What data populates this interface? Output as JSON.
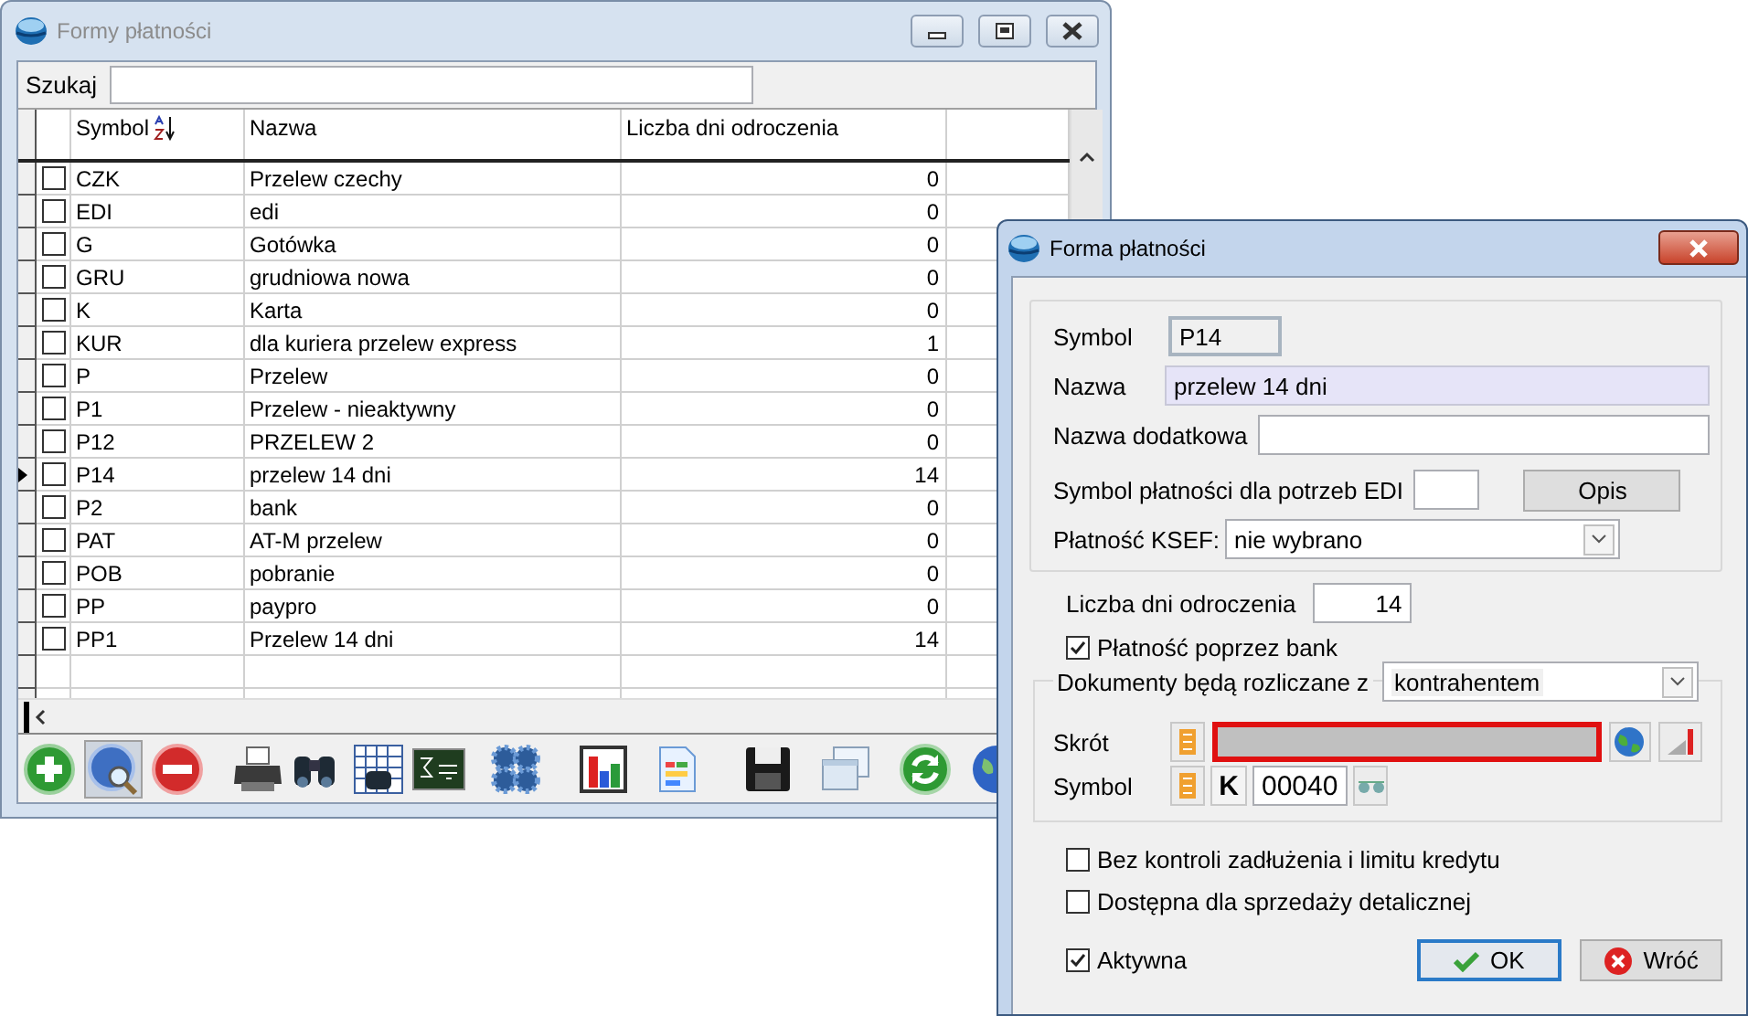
{
  "main_window": {
    "title": "Formy płatności",
    "active": false,
    "search": {
      "label": "Szukaj"
    },
    "table": {
      "columns": [
        "Symbol",
        "Nazwa",
        "Liczba dni odroczenia"
      ],
      "sorted_by_symbol": true,
      "rows": [
        {
          "symbol": "CZK",
          "name": "Przelew czechy",
          "days": "0",
          "checked": false,
          "selected": false
        },
        {
          "symbol": "EDI",
          "name": "edi",
          "days": "0",
          "checked": false,
          "selected": false
        },
        {
          "symbol": "G",
          "name": "Gotówka",
          "days": "0",
          "checked": false,
          "selected": false
        },
        {
          "symbol": "GRU",
          "name": "grudniowa nowa",
          "days": "0",
          "checked": false,
          "selected": false
        },
        {
          "symbol": "K",
          "name": "Karta",
          "days": "0",
          "checked": false,
          "selected": false
        },
        {
          "symbol": "KUR",
          "name": "dla kuriera przelew express",
          "days": "1",
          "checked": false,
          "selected": false
        },
        {
          "symbol": "P",
          "name": "Przelew",
          "days": "0",
          "checked": false,
          "selected": false
        },
        {
          "symbol": "P1",
          "name": "Przelew - nieaktywny",
          "days": "0",
          "checked": false,
          "selected": false
        },
        {
          "symbol": "P12",
          "name": "PRZELEW 2",
          "days": "0",
          "checked": false,
          "selected": false
        },
        {
          "symbol": "P14",
          "name": "przelew 14 dni",
          "days": "14",
          "checked": false,
          "selected": true
        },
        {
          "symbol": "P2",
          "name": "bank",
          "days": "0",
          "checked": false,
          "selected": false
        },
        {
          "symbol": "PAT",
          "name": "AT-M przelew",
          "days": "0",
          "checked": false,
          "selected": false
        },
        {
          "symbol": "POB",
          "name": "pobranie",
          "days": "0",
          "checked": false,
          "selected": false
        },
        {
          "symbol": "PP",
          "name": "paypro",
          "days": "0",
          "checked": false,
          "selected": false
        },
        {
          "symbol": "PP1",
          "name": "Przelew 14 dni",
          "days": "14",
          "checked": false,
          "selected": false
        }
      ]
    },
    "toolbar": [
      {
        "kind": "add",
        "pressed": false
      },
      {
        "kind": "find",
        "pressed": true
      },
      {
        "kind": "delete",
        "pressed": false
      },
      {
        "kind": "print",
        "pressed": false
      },
      {
        "kind": "binoculars",
        "pressed": false
      },
      {
        "kind": "table-search",
        "pressed": false
      },
      {
        "kind": "formula",
        "pressed": false
      },
      {
        "kind": "gears",
        "pressed": false
      },
      {
        "kind": "chart",
        "pressed": false
      },
      {
        "kind": "document",
        "pressed": false
      },
      {
        "kind": "save",
        "pressed": false
      },
      {
        "kind": "windows",
        "pressed": false
      },
      {
        "kind": "refresh",
        "pressed": false
      },
      {
        "kind": "globe",
        "pressed": false
      }
    ]
  },
  "dialog": {
    "title": "Forma płatności",
    "active": true,
    "symbol": {
      "label": "Symbol",
      "value": "P14",
      "disabled": true
    },
    "name": {
      "label": "Nazwa",
      "value": "przelew 14 dni"
    },
    "extra_name": {
      "label": "Nazwa dodatkowa"
    },
    "edi": {
      "label": "Symbol płatności dla potrzeb EDI",
      "button": "Opis"
    },
    "ksef": {
      "label": "Płatność KSEF:",
      "value": "nie wybrano"
    },
    "days": {
      "label": "Liczba dni odroczenia",
      "value": "14"
    },
    "bank": {
      "label": "Płatność poprzez bank",
      "checked": true
    },
    "settlement": {
      "label": "Dokumenty będą rozliczane z",
      "value": "kontrahentem",
      "short": {
        "label": "Skrót",
        "invalid": true
      },
      "symbol": {
        "label": "Symbol",
        "prefix": "K",
        "value": "00040"
      }
    },
    "options": [
      {
        "label": "Bez kontroli zadłużenia i limitu kredytu",
        "checked": false
      },
      {
        "label": "Dostępna dla sprzedaży detalicznej",
        "checked": false
      }
    ],
    "active_flag": {
      "label": "Aktywna",
      "checked": true
    },
    "buttons": [
      {
        "kind": "ok",
        "label": "OK",
        "default": true
      },
      {
        "kind": "cancel",
        "label": "Wróć",
        "default": false
      }
    ]
  }
}
